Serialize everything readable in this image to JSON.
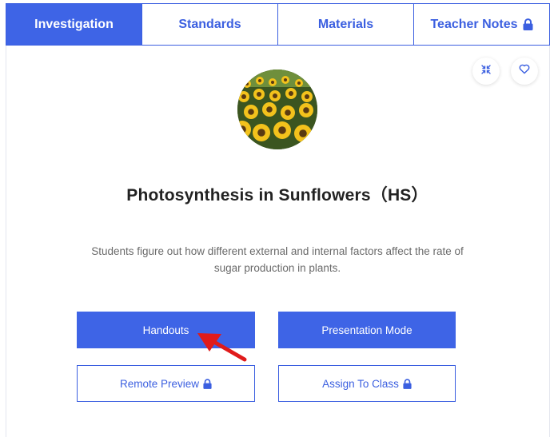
{
  "tabs": [
    {
      "label": "Investigation",
      "active": true
    },
    {
      "label": "Standards",
      "active": false
    },
    {
      "label": "Materials",
      "active": false
    },
    {
      "label": "Teacher Notes",
      "active": false,
      "locked": true
    }
  ],
  "card": {
    "actions": {
      "collapse_icon": "collapse-icon",
      "favorite_icon": "heart-icon"
    },
    "image_subject": "sunflower field",
    "title": "Photosynthesis in Sunflowers（HS）",
    "description": "Students figure out how different external and internal factors affect the rate of sugar production in plants."
  },
  "buttons": {
    "handouts": "Handouts",
    "presentation_mode": "Presentation Mode",
    "remote_preview": "Remote Preview",
    "assign_to_class": "Assign To Class"
  },
  "colors": {
    "accent": "#3e64e6",
    "annotation_arrow": "#e01b1b"
  }
}
